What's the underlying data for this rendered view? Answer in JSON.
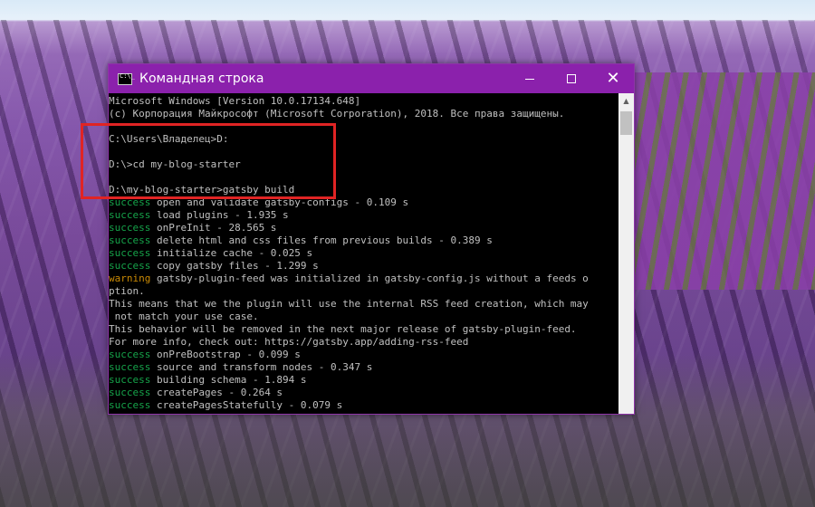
{
  "window": {
    "title": "Командная строка",
    "controls": {
      "minimize": "—",
      "maximize": "□",
      "close": "✕"
    }
  },
  "console": {
    "lines": [
      {
        "status": "",
        "text": "Microsoft Windows [Version 10.0.17134.648]"
      },
      {
        "status": "",
        "text": "(c) Корпорация Майкрософт (Microsoft Corporation), 2018. Все права защищены."
      },
      {
        "status": "",
        "text": ""
      },
      {
        "status": "",
        "text": "C:\\Users\\Владелец>D:"
      },
      {
        "status": "",
        "text": ""
      },
      {
        "status": "",
        "text": "D:\\>cd my-blog-starter"
      },
      {
        "status": "",
        "text": ""
      },
      {
        "status": "",
        "text": "D:\\my-blog-starter>gatsby build"
      },
      {
        "status": "success",
        "text": " open and validate gatsby-configs - 0.109 s"
      },
      {
        "status": "success",
        "text": " load plugins - 1.935 s"
      },
      {
        "status": "success",
        "text": " onPreInit - 28.565 s"
      },
      {
        "status": "success",
        "text": " delete html and css files from previous builds - 0.389 s"
      },
      {
        "status": "success",
        "text": " initialize cache - 0.025 s"
      },
      {
        "status": "success",
        "text": " copy gatsby files - 1.299 s"
      },
      {
        "status": "warning",
        "text": " gatsby-plugin-feed was initialized in gatsby-config.js without a feeds o"
      },
      {
        "status": "",
        "text": "ption."
      },
      {
        "status": "",
        "text": "This means that we the plugin will use the internal RSS feed creation, which may"
      },
      {
        "status": "",
        "text": " not match your use case."
      },
      {
        "status": "",
        "text": "This behavior will be removed in the next major release of gatsby-plugin-feed."
      },
      {
        "status": "",
        "text": "For more info, check out: https://gatsby.app/adding-rss-feed"
      },
      {
        "status": "success",
        "text": " onPreBootstrap - 0.099 s"
      },
      {
        "status": "success",
        "text": " source and transform nodes - 0.347 s"
      },
      {
        "status": "success",
        "text": " building schema - 1.894 s"
      },
      {
        "status": "success",
        "text": " createPages - 0.264 s"
      },
      {
        "status": "success",
        "text": " createPagesStatefully - 0.079 s"
      }
    ]
  },
  "colors": {
    "titlebar": "#8b21ac",
    "success": "#16a34a",
    "warning": "#ca8a04",
    "highlight": "#e02424"
  }
}
